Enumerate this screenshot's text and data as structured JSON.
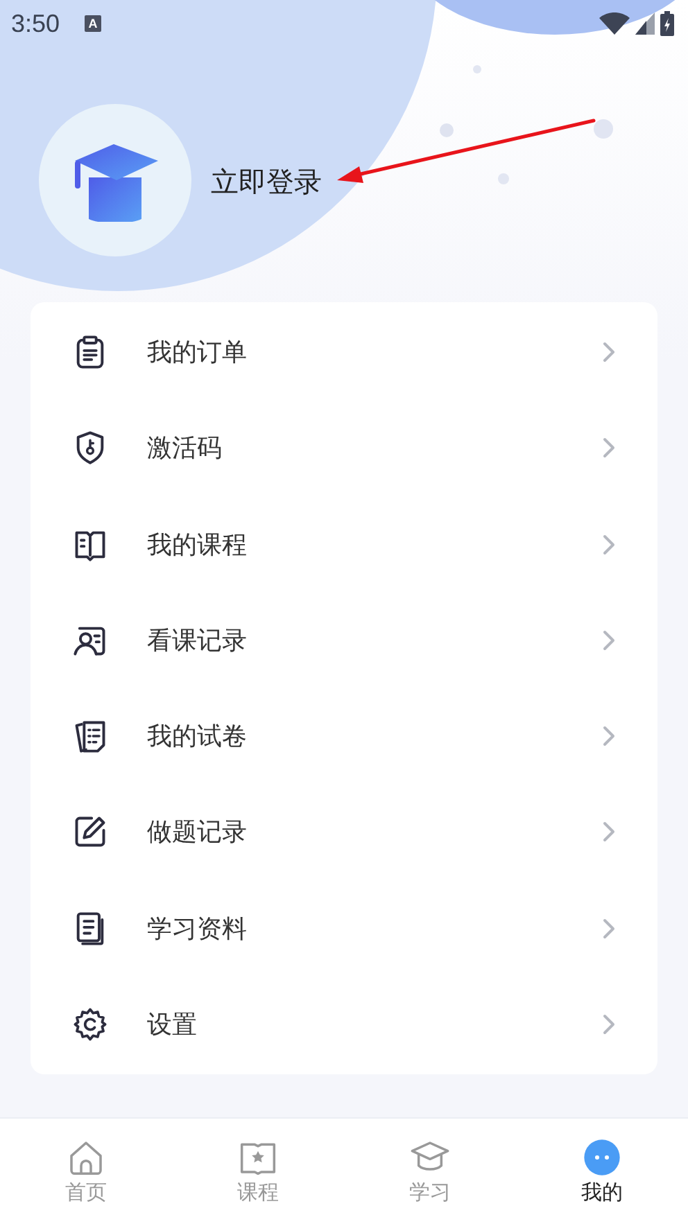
{
  "status_bar": {
    "time": "3:50",
    "badge": "A"
  },
  "profile": {
    "login_label": "立即登录"
  },
  "menu": [
    {
      "label": "我的订单"
    },
    {
      "label": "激活码"
    },
    {
      "label": "我的课程"
    },
    {
      "label": "看课记录"
    },
    {
      "label": "我的试卷"
    },
    {
      "label": "做题记录"
    },
    {
      "label": "学习资料"
    },
    {
      "label": "设置"
    }
  ],
  "tabs": [
    {
      "label": "首页",
      "selected": false
    },
    {
      "label": "课程",
      "selected": false
    },
    {
      "label": "学习",
      "selected": false
    },
    {
      "label": "我的",
      "selected": true
    }
  ]
}
